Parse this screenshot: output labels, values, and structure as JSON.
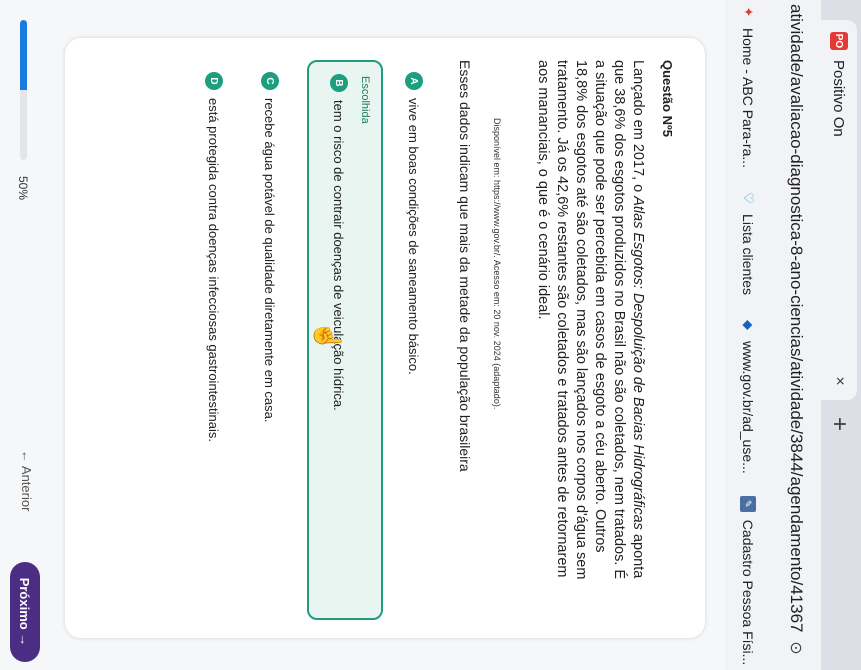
{
  "browser": {
    "tab_title": "Positivo On",
    "tab_icon": "PO",
    "tab_close": "×",
    "new_tab": "+",
    "url": "atividade/avaliacao-diagnostica-8-ano-ciencias/atividade/3844/agendamento/41367/ca...",
    "bookmarks": [
      {
        "label": "Home - ABC Para-ra...",
        "icon": "star-icon"
      },
      {
        "label": "Lista clientes",
        "icon": "shield-icon"
      },
      {
        "label": "www.gov.br/ad_use...",
        "icon": "gov-icon"
      },
      {
        "label": "Cadastro Pessoa Físi...",
        "icon": "doc-icon"
      }
    ]
  },
  "question": {
    "number": "Questão Nº5",
    "text_intro": "Lançado em 2017, o ",
    "text_title": "Atlas Esgotos: Despoluição de Bacias Hidrográficas",
    "text_rest": " aponta que 38,6% dos esgotos produzidos no Brasil não são coletados, nem tratados. É a situação que pode ser percebida em casos de esgoto a céu aberto. Outros 18,8% dos esgotos até são coletados, mas são lançados nos corpos d'água sem tratamento. Já os 42,6% restantes são coletados e tratados antes de retornarem aos mananciais, o que é o cenário ideal.",
    "source": "Disponível em: https://www.gov.br/. Acesso em: 20 nov. 2024 (adaptado).",
    "prompt": "Esses dados indicam que mais da metade da população brasileira",
    "options": [
      {
        "letter": "A",
        "text": "vive em boas condições de saneamento básico."
      },
      {
        "letter": "B",
        "text": "tem o risco de contrair doenças de veiculação hídrica.",
        "chosen_label": "Escolhida"
      },
      {
        "letter": "C",
        "text": "recebe água potável de qualidade diretamente em casa."
      },
      {
        "letter": "D",
        "text": "está protegida contra doenças infecciosas gastrointestinais."
      }
    ]
  },
  "footer": {
    "progress_percent": 50,
    "progress_label": "50%",
    "prev_label": "←  Anterior",
    "next_label": "Próximo  →"
  },
  "colors": {
    "accent": "#1d9e7e",
    "next_button": "#4b2d83",
    "progress": "#1b7ce0"
  }
}
